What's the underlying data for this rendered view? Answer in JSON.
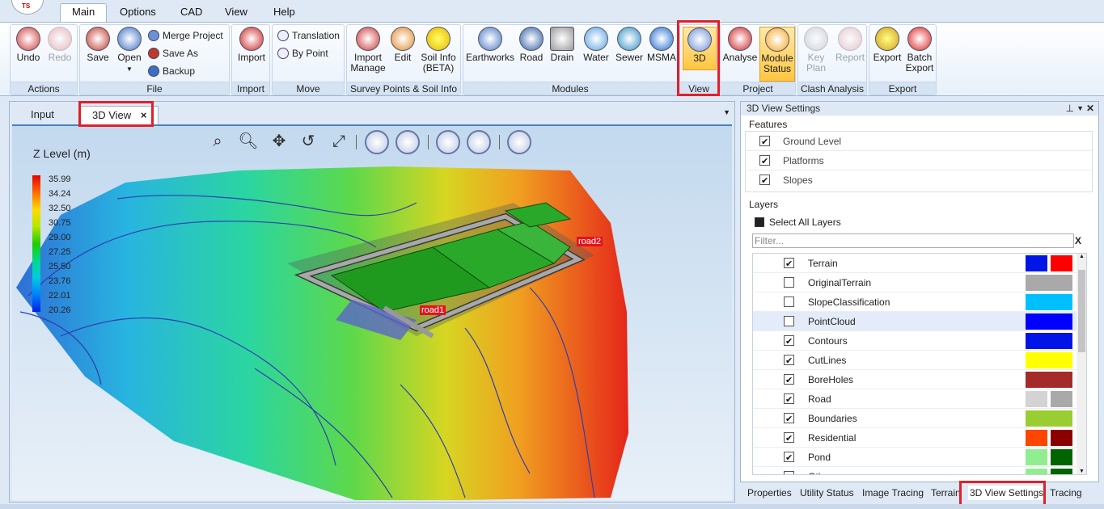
{
  "ribbon_tabs": [
    "Main",
    "Options",
    "CAD",
    "View",
    "Help"
  ],
  "groups": {
    "actions": {
      "name": "Actions",
      "undo": "Undo",
      "redo": "Redo"
    },
    "file": {
      "name": "File",
      "save": "Save",
      "open": "Open",
      "merge": "Merge Project",
      "save_as": "Save As",
      "backup": "Backup"
    },
    "import": {
      "name": "Import",
      "import": "Import"
    },
    "move": {
      "name": "Move",
      "translation": "Translation",
      "by_point": "By Point"
    },
    "survey": {
      "name": "Survey Points & Soil Info",
      "import_manage": "Import Manage",
      "edit": "Edit",
      "soil_info": "Soil Info (BETA)"
    },
    "modules": {
      "name": "Modules",
      "earthworks": "Earthworks",
      "road": "Road",
      "drain": "Drain",
      "water": "Water",
      "sewer": "Sewer",
      "msma": "MSMA"
    },
    "view": {
      "name": "View",
      "threed": "3D"
    },
    "project": {
      "name": "Project",
      "analyse": "Analyse",
      "module_status": "Module Status"
    },
    "clash": {
      "name": "Clash Analysis",
      "key_plan": "Key Plan",
      "report": "Report"
    },
    "export": {
      "name": "Export",
      "export": "Export",
      "batch_export": "Batch Export"
    }
  },
  "doc_tabs": {
    "input": "Input",
    "view3d": "3D View",
    "close": "×"
  },
  "legend": {
    "title": "Z Level (m)",
    "values": [
      "35.99",
      "34.24",
      "32.50",
      "30.75",
      "29.00",
      "27.25",
      "25.50",
      "23.76",
      "22.01",
      "20.26"
    ]
  },
  "road_labels": {
    "road1": "road1",
    "road2": "road2"
  },
  "settings": {
    "title": "3D View Settings",
    "features_label": "Features",
    "features": [
      {
        "label": "Ground Level",
        "checked": true
      },
      {
        "label": "Platforms",
        "checked": true
      },
      {
        "label": "Slopes",
        "checked": true
      }
    ],
    "layers_label": "Layers",
    "select_all": "Select All Layers",
    "filter_placeholder": "Filter...",
    "filter_clear": "X",
    "layers": [
      {
        "label": "Terrain",
        "checked": true,
        "colors": [
          "#0015e6",
          "#ff0000"
        ]
      },
      {
        "label": "OriginalTerrain",
        "checked": false,
        "colors": [
          "#a9a9a9"
        ]
      },
      {
        "label": "SlopeClassification",
        "checked": false,
        "colors": [
          "#00bfff"
        ]
      },
      {
        "label": "PointCloud",
        "checked": false,
        "colors": [
          "#0000ff"
        ]
      },
      {
        "label": "Contours",
        "checked": true,
        "colors": [
          "#0015e6"
        ]
      },
      {
        "label": "CutLines",
        "checked": true,
        "colors": [
          "#ffff00"
        ]
      },
      {
        "label": "BoreHoles",
        "checked": true,
        "colors": [
          "#a52a2a"
        ]
      },
      {
        "label": "Road",
        "checked": true,
        "colors": [
          "#d3d3d3",
          "#a9a9a9"
        ]
      },
      {
        "label": "Boundaries",
        "checked": true,
        "colors": [
          "#9acd32"
        ]
      },
      {
        "label": "Residential",
        "checked": true,
        "colors": [
          "#ff4500",
          "#8b0000"
        ]
      },
      {
        "label": "Pond",
        "checked": true,
        "colors": [
          "#90ee90",
          "#006400"
        ]
      },
      {
        "label": "Oth",
        "checked": true,
        "colors": [
          "#90ee90",
          "#006400"
        ]
      }
    ]
  },
  "bottom_tabs": [
    "Properties",
    "Utility Status",
    "Image Tracing",
    "Terrain",
    "3D View Settings",
    "Tracing"
  ]
}
